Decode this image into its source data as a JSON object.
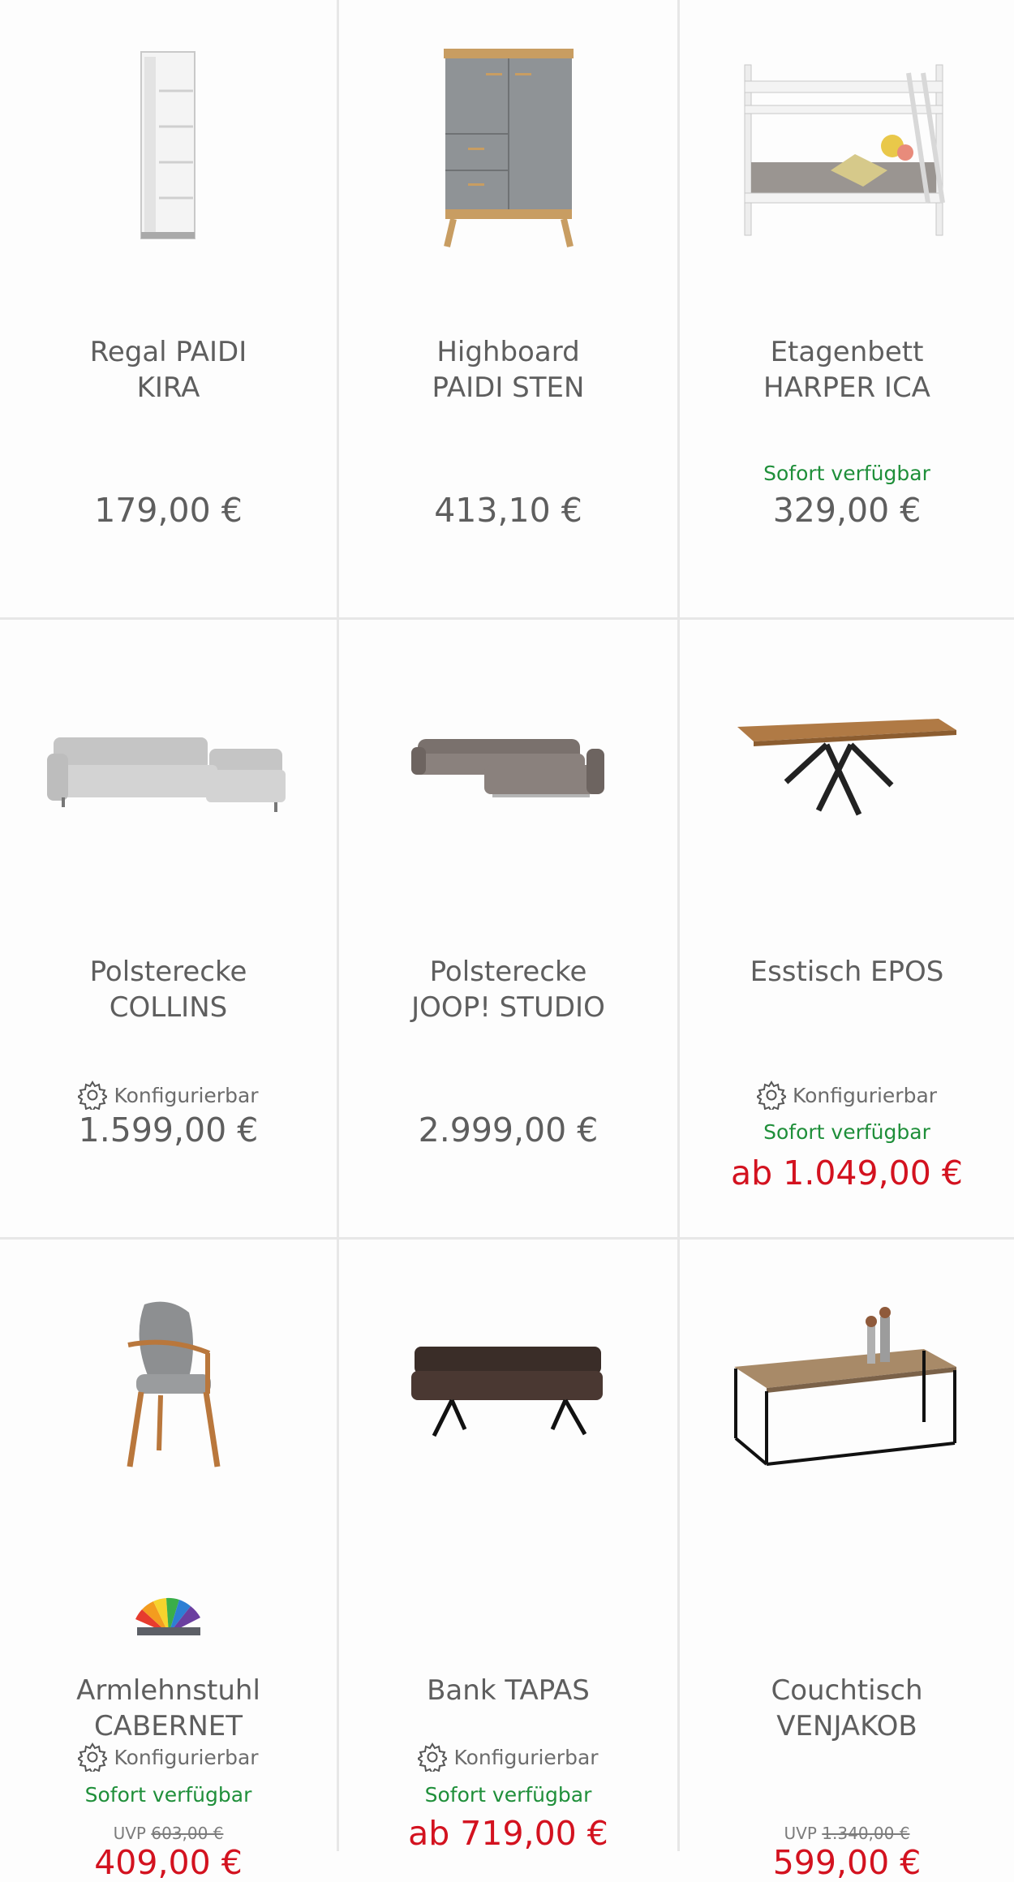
{
  "products": [
    {
      "name_line1": "Regal PAIDI",
      "name_line2": "KIRA",
      "price": "179,00 €",
      "image": "tall-white-shelf"
    },
    {
      "name_line1": "Highboard",
      "name_line2": "PAIDI STEN",
      "price": "413,10 €",
      "image": "grey-highboard"
    },
    {
      "name_line1": "Etagenbett",
      "name_line2": "HARPER ICA",
      "availability": "Sofort verfügbar",
      "price": "329,00 €",
      "image": "white-bunk-bed"
    },
    {
      "name_line1": "Polsterecke",
      "name_line2": "COLLINS",
      "config": "Konfigurierbar",
      "price": "1.599,00 €",
      "image": "light-grey-corner-sofa"
    },
    {
      "name_line1": "Polsterecke",
      "name_line2": "JOOP! STUDIO",
      "price": "2.999,00 €",
      "image": "taupe-corner-sofa"
    },
    {
      "name_line1": "Esstisch EPOS",
      "name_line2": "",
      "config": "Konfigurierbar",
      "availability": "Sofort verfügbar",
      "price": "ab 1.049,00 €",
      "image": "oak-dining-table"
    },
    {
      "name_line1": "Armlehnstuhl",
      "name_line2": "CABERNET",
      "config": "Konfigurierbar",
      "availability": "Sofort verfügbar",
      "uvp_label": "UVP",
      "uvp_price": "603,00 €",
      "price": "409,00 €",
      "image": "grey-armchair"
    },
    {
      "name_line1": "Bank TAPAS",
      "name_line2": "",
      "config": "Konfigurierbar",
      "availability": "Sofort verfügbar",
      "price": "ab 719,00 €",
      "image": "dark-bench"
    },
    {
      "name_line1": "Couchtisch",
      "name_line2": "VENJAKOB",
      "uvp_label": "UVP",
      "uvp_price": "1.340,00 €",
      "price": "599,00 €",
      "image": "coffee-table"
    }
  ],
  "colors": {
    "price_sale": "#d3121f",
    "availability": "#1f8f3a",
    "text": "#5e5e5e"
  },
  "icons": {
    "config": "gear-icon",
    "color_options": "color-fan-icon"
  }
}
